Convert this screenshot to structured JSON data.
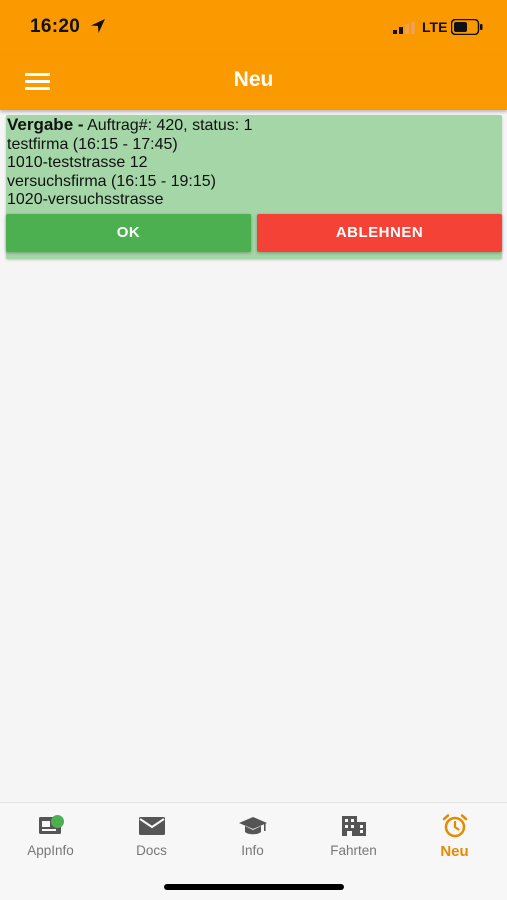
{
  "status_bar": {
    "time": "16:20",
    "network": "LTE"
  },
  "header": {
    "title": "Neu"
  },
  "card": {
    "heading_bold": "Vergabe -",
    "heading_rest": "Auftrag#: 420, status: 1",
    "lines": [
      "testfirma (16:15 - 17:45)",
      "1010-teststrasse 12",
      "versuchsfirma (16:15 - 19:15)",
      "1020-versuchsstrasse"
    ],
    "ok_label": "OK",
    "reject_label": "ABLEHNEN"
  },
  "tabs": [
    {
      "label": "AppInfo",
      "icon": "appinfo-icon"
    },
    {
      "label": "Docs",
      "icon": "mail-icon"
    },
    {
      "label": "Info",
      "icon": "graduation-cap-icon"
    },
    {
      "label": "Fahrten",
      "icon": "building-icon"
    },
    {
      "label": "Neu",
      "icon": "alarm-clock-icon",
      "active": true
    }
  ],
  "colors": {
    "primary": "#fb9a00",
    "card_bg": "#a5d6a7",
    "ok": "#4caf50",
    "reject": "#f44336",
    "active_tab": "#e68a00"
  }
}
